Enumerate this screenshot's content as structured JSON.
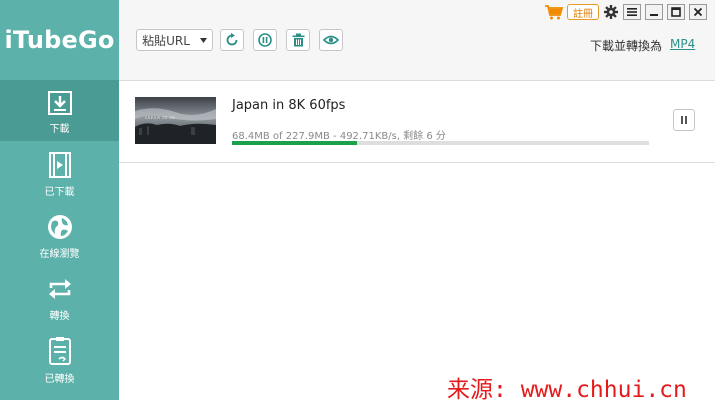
{
  "app": {
    "name": "iTubeGo"
  },
  "sidebar": {
    "items": [
      {
        "label": "下載",
        "icon": "download-icon",
        "active": true
      },
      {
        "label": "已下載",
        "icon": "video-file-icon",
        "active": false
      },
      {
        "label": "在線瀏覽",
        "icon": "globe-icon",
        "active": false
      },
      {
        "label": "轉換",
        "icon": "convert-icon",
        "active": false
      },
      {
        "label": "已轉換",
        "icon": "converted-file-icon",
        "active": false
      }
    ]
  },
  "toolbar": {
    "paste_label": "粘貼URL",
    "convert_label": "下載並轉換為",
    "convert_format": "MP4",
    "register_label": "註冊"
  },
  "download": {
    "title": "Japan in 8K 60fps",
    "stats": "68.4MB of 227.9MB - 492.71KB/s, 剩餘 6 分",
    "progress": 0.3,
    "thumb_text": "JAPAN IN 8K"
  },
  "watermark": "来源: www.chhui.cn",
  "colors": {
    "sidebar": "#5cb1aa",
    "sidebar_active": "#4b9b95",
    "accent": "#2b8f88",
    "progress": "#1aa14b",
    "register": "#e07f00",
    "watermark": "#e51b1b"
  }
}
